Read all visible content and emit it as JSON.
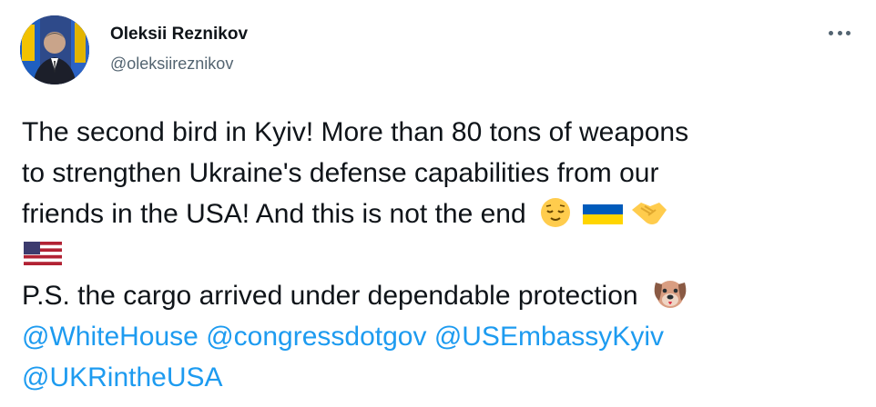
{
  "author": {
    "name": "Oleksii Reznikov",
    "handle": "@oleksiireznikov"
  },
  "more_icon": "more-horizontal-icon",
  "tweet": {
    "line1": "The second bird in Kyiv! More than 80 tons of weapons",
    "line2": "to strengthen Ukraine's defense capabilities from our",
    "line3": "friends in the USA! And this is not the end",
    "line5": "P.S. the cargo arrived under dependable protection",
    "mentions": [
      "@WhiteHouse",
      "@congressdotgov",
      "@USEmbassyKyiv",
      "@UKRintheUSA"
    ],
    "emojis": [
      "relieved-face",
      "flag-ukraine",
      "handshake",
      "flag-usa",
      "dog-face"
    ]
  },
  "colors": {
    "text": "#0f1419",
    "secondary": "#536471",
    "link": "#1d9bf0"
  }
}
